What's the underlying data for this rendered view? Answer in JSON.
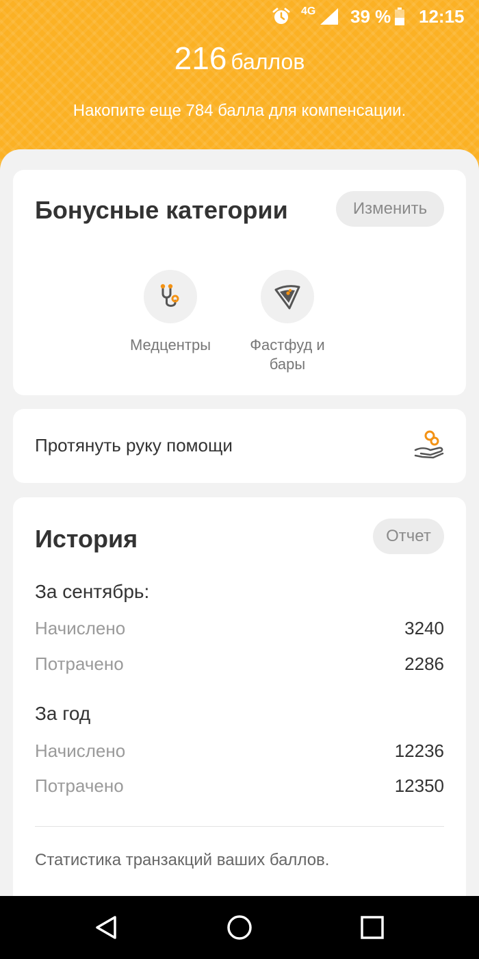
{
  "status_bar": {
    "network": "4G",
    "battery": "39 %",
    "time": "12:15"
  },
  "header": {
    "points_value": "216",
    "points_unit": "баллов",
    "subtitle": "Накопите еще 784 балла для компенсации."
  },
  "bonus_categories": {
    "title": "Бонусные категории",
    "edit_label": "Изменить",
    "items": [
      {
        "label": "Медцентры",
        "icon": "stethoscope-icon"
      },
      {
        "label": "Фастфуд и бары",
        "icon": "pizza-slice-icon"
      }
    ]
  },
  "help": {
    "label": "Протянуть руку помощи",
    "icon": "hand-coin-icon"
  },
  "history": {
    "title": "История",
    "report_label": "Отчет",
    "periods": [
      {
        "title": "За сентябрь:",
        "rows": [
          {
            "label": "Начислено",
            "value": "3240"
          },
          {
            "label": "Потрачено",
            "value": "2286"
          }
        ]
      },
      {
        "title": "За год",
        "rows": [
          {
            "label": "Начислено",
            "value": "12236"
          },
          {
            "label": "Потрачено",
            "value": "12350"
          }
        ]
      }
    ],
    "footnote": "Статистика транзакций ваших баллов."
  },
  "colors": {
    "accent": "#fbb124",
    "icon_orange": "#f39214",
    "icon_gray": "#555555"
  }
}
